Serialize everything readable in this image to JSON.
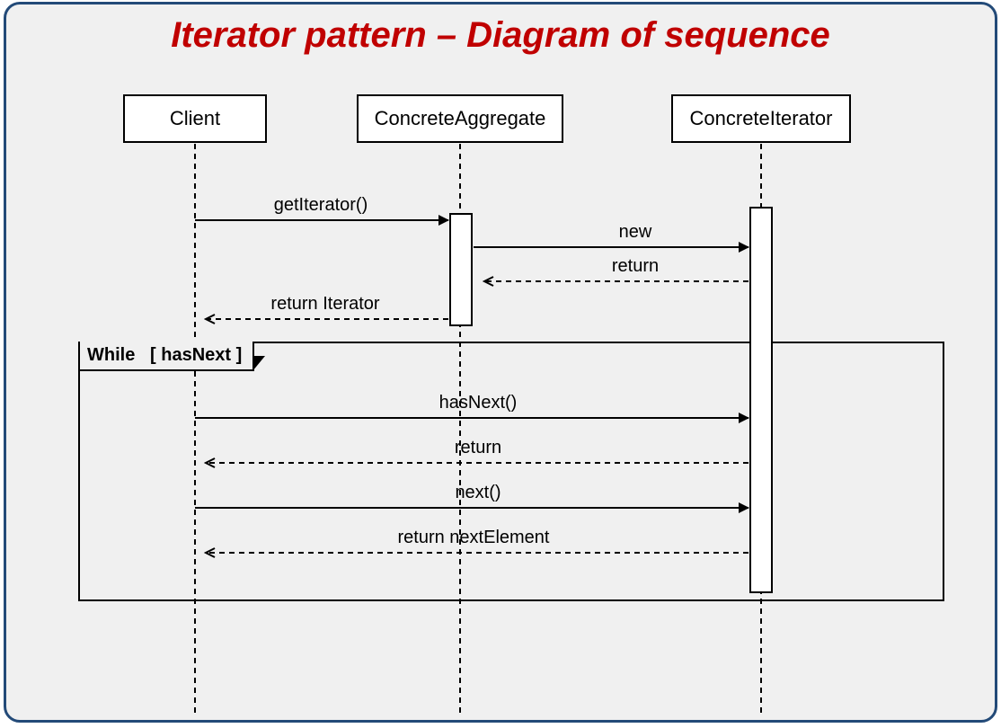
{
  "title": "Iterator pattern – Diagram of sequence",
  "participants": {
    "client": "Client",
    "aggregate": "ConcreteAggregate",
    "iterator": "ConcreteIterator"
  },
  "messages": {
    "getIterator": "getIterator()",
    "new": "new",
    "returnNew": "return",
    "returnIterator": "return Iterator",
    "hasNext": "hasNext()",
    "returnHasNext": "return",
    "next": "next()",
    "returnNext": "return nextElement"
  },
  "loop": {
    "label": "While",
    "guard": "[ hasNext ]"
  }
}
